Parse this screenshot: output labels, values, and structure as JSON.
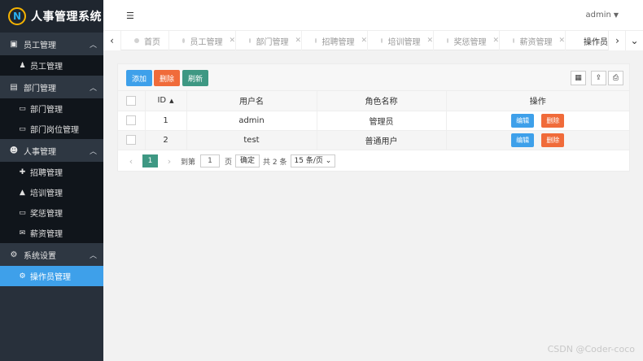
{
  "app": {
    "title": "人事管理系统",
    "logo_letter": "N"
  },
  "header": {
    "user": "admin",
    "menu_toggle_icon": "hamburger-icon"
  },
  "sidebar": {
    "groups": [
      {
        "label": "员工管理",
        "icon": "id-card-icon",
        "items": [
          {
            "label": "员工管理",
            "icon": "person-icon"
          }
        ]
      },
      {
        "label": "部门管理",
        "icon": "address-card-icon",
        "items": [
          {
            "label": "部门管理",
            "icon": "id-badge-icon"
          },
          {
            "label": "部门岗位管理",
            "icon": "id-card-icon"
          }
        ]
      },
      {
        "label": "人事管理",
        "icon": "users-icon",
        "items": [
          {
            "label": "招聘管理",
            "icon": "user-plus-icon"
          },
          {
            "label": "培训管理",
            "icon": "graduation-cap-icon"
          },
          {
            "label": "奖惩管理",
            "icon": "desktop-icon"
          },
          {
            "label": "薪资管理",
            "icon": "envelope-icon"
          }
        ]
      },
      {
        "label": "系统设置",
        "icon": "cogs-icon",
        "items": [
          {
            "label": "操作员管理",
            "icon": "cogs-icon",
            "active": true
          }
        ]
      }
    ]
  },
  "tabs": [
    {
      "label": "首页",
      "closable": false
    },
    {
      "label": "员工管理",
      "closable": true
    },
    {
      "label": "部门管理",
      "closable": true
    },
    {
      "label": "招聘管理",
      "closable": true
    },
    {
      "label": "培训管理",
      "closable": true
    },
    {
      "label": "奖惩管理",
      "closable": true
    },
    {
      "label": "薪资管理",
      "closable": true
    },
    {
      "label": "操作员管",
      "closable": false,
      "active": true
    }
  ],
  "toolbar": {
    "add_label": "添加",
    "delete_label": "删除",
    "refresh_label": "刷新"
  },
  "table": {
    "columns": [
      "ID",
      "用户名",
      "角色名称",
      "操作"
    ],
    "rows": [
      {
        "id": "1",
        "username": "admin",
        "role": "管理员"
      },
      {
        "id": "2",
        "username": "test",
        "role": "普通用户"
      }
    ],
    "edit_label": "编辑",
    "delete_label": "删除"
  },
  "pager": {
    "current_page": "1",
    "goto_label": "到第",
    "goto_value": "1",
    "page_unit": "页",
    "confirm_label": "确定",
    "total_label": "共 2 条",
    "page_size_label": "15 条/页"
  },
  "watermark": "CSDN @Coder-coco",
  "colors": {
    "sidebar_bg": "#28303b",
    "accent_blue": "#3ea0ea",
    "danger_orange": "#f06b3a",
    "teal": "#3e9883"
  }
}
